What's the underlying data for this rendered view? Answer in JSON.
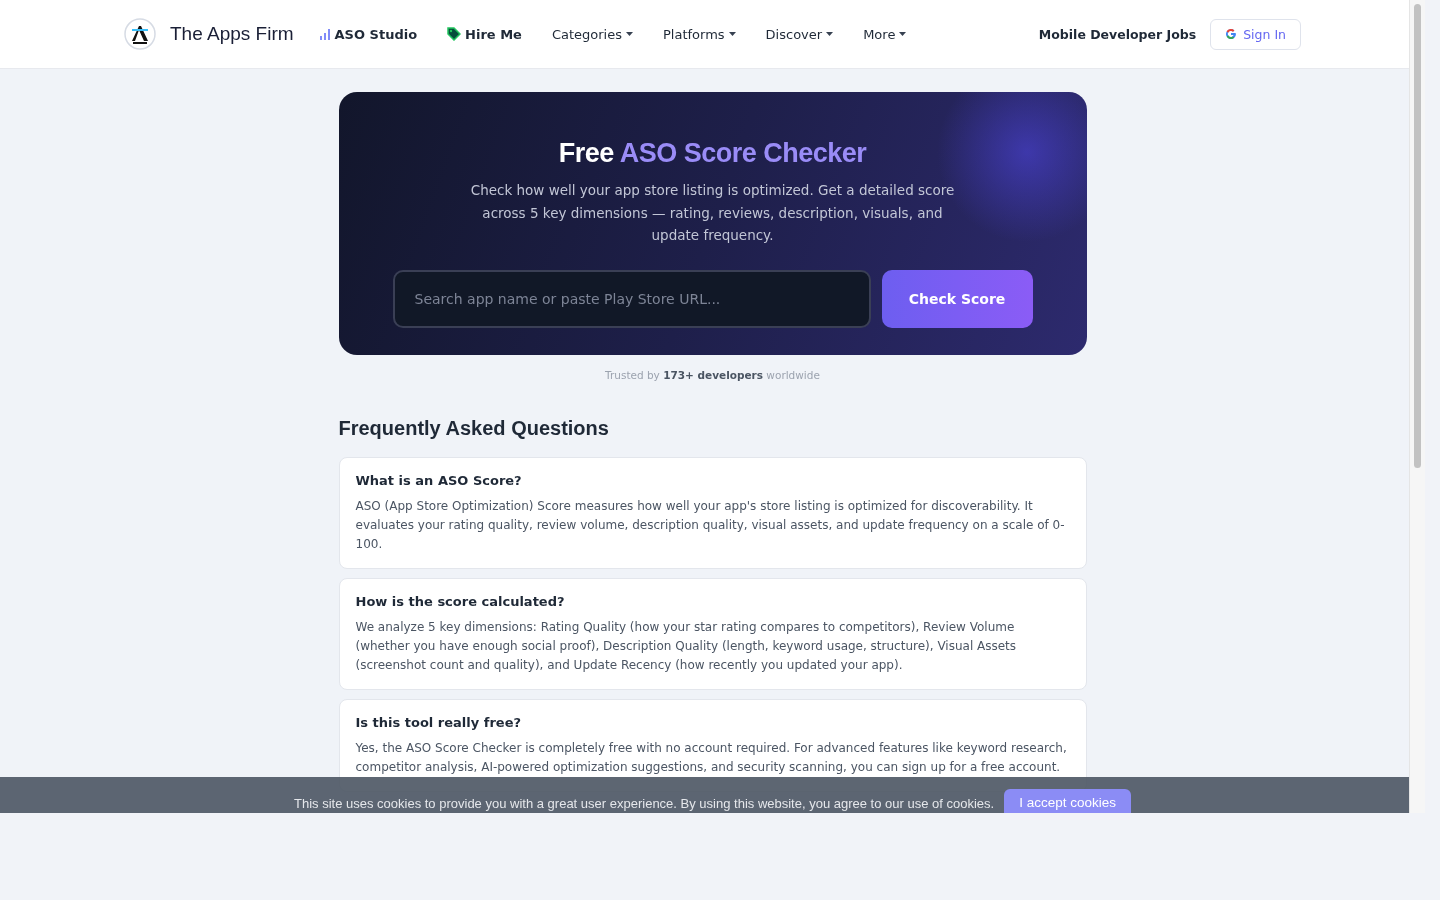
{
  "header": {
    "brand": "The Apps Firm",
    "nav": [
      {
        "label": "ASO Studio",
        "kind": "chart"
      },
      {
        "label": "Hire Me",
        "kind": "tag"
      },
      {
        "label": "Categories",
        "kind": "dropdown"
      },
      {
        "label": "Platforms",
        "kind": "dropdown"
      },
      {
        "label": "Discover",
        "kind": "dropdown"
      },
      {
        "label": "More",
        "kind": "dropdown"
      }
    ],
    "jobs_link": "Mobile Developer Jobs",
    "sign_in": "Sign In"
  },
  "hero": {
    "title_plain": "Free",
    "title_accent": "ASO Score Checker",
    "description": "Check how well your app store listing is optimized. Get a detailed score across 5 key dimensions — rating, reviews, description, visuals, and update frequency.",
    "search": {
      "placeholder": "Search app name or paste Play Store URL..."
    },
    "button": "Check Score"
  },
  "trust_note": "Trusted by **173+ developers** worldwide",
  "faq": {
    "title": "Frequently Asked Questions",
    "items": [
      {
        "question": "What is an ASO Score?",
        "answer": "ASO (App Store Optimization) Score measures how well your app's store listing is optimized for discoverability. It evaluates your rating quality, review volume, description quality, visual assets, and update frequency on a scale of 0-100."
      },
      {
        "question": "How is the score calculated?",
        "answer": "We analyze 5 key dimensions: Rating Quality (how your star rating compares to competitors), Review Volume (whether you have enough social proof), Description Quality (length, keyword usage, structure), Visual Assets (screenshot count and quality), and Update Recency (how recently you updated your app)."
      },
      {
        "question": "Is this tool really free?",
        "answer": "Yes, the ASO Score Checker is completely free with no account required. For advanced features like keyword research, competitor analysis, AI-powered optimization suggestions, and security scanning, you can sign up for a free account."
      }
    ]
  },
  "cookie_banner": {
    "text": "This site uses cookies to provide you with a great user experience. By using this website, you agree to our use of cookies.",
    "button": "I accept cookies"
  }
}
